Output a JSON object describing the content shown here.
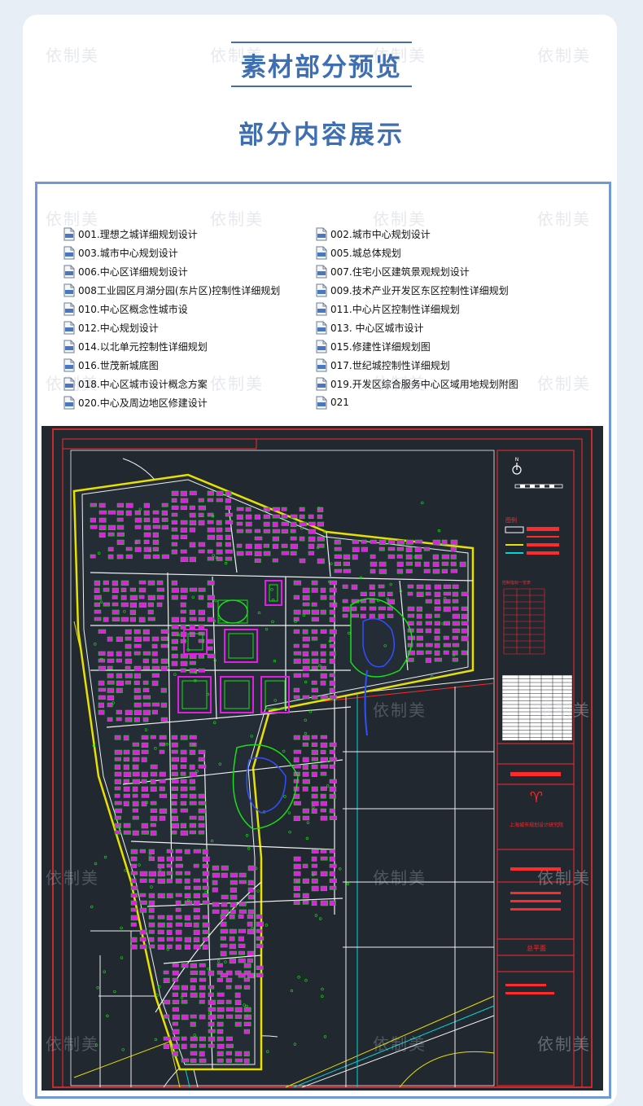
{
  "watermark_text": "依制美",
  "header": {
    "title": "素材部分预览",
    "subtitle": "部分内容展示"
  },
  "file_list": {
    "left": [
      "001.理想之城详细规划设计",
      "003.城市中心规划设计",
      "006.中心区详细规划设计",
      "008工业园区月湖分园(东片区)控制性详细规划",
      "010.中心区概念性城市设",
      "012.中心规划设计",
      "014.以北单元控制性详细规划",
      "016.世茂新城底图",
      "018.中心区城市设计概念方案",
      "020.中心及周边地区修建设计"
    ],
    "right": [
      "002.城市中心规划设计",
      "005.城总体规划",
      "007.住宅小区建筑景观规划设计",
      "009.技术产业开发区东区控制性详细规划",
      "011.中心片区控制性详细规划",
      "013. 中心区城市设计",
      "015.修建性详细规划图",
      "017.世纪城控制性详细规划",
      "019.开发区综合服务中心区域用地规划附图",
      "021"
    ]
  },
  "cad_preview": {
    "legend_title": "图例",
    "table_title": "控制指标一览表",
    "institute_name": "上海城市规划设计研究院",
    "drawing_name": "总平面",
    "compass_label": "N",
    "colors": {
      "background": "#212830",
      "frame": "#ff2a2a",
      "building": "#e020e0",
      "green": "#18e018",
      "road": "#f0f0f0",
      "yellow_road": "#e8e000",
      "cyan": "#00d8d8",
      "accent_blue": "#3f6fb3"
    }
  }
}
